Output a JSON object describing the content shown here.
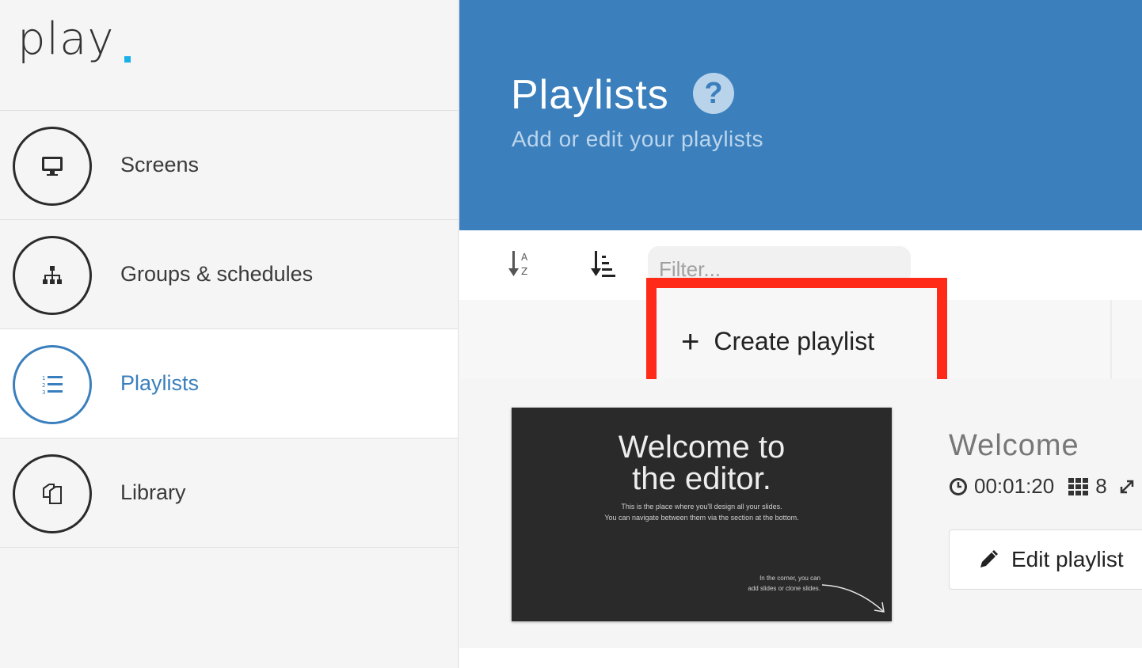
{
  "app": {
    "logo_text": "play",
    "accent_color": "#1ab0e8"
  },
  "sidebar": {
    "items": [
      {
        "label": "Screens",
        "icon": "monitor-icon",
        "active": false
      },
      {
        "label": "Groups & schedules",
        "icon": "sitemap-icon",
        "active": false
      },
      {
        "label": "Playlists",
        "icon": "ordered-list-icon",
        "active": true
      },
      {
        "label": "Library",
        "icon": "copy-icon",
        "active": false
      }
    ]
  },
  "header": {
    "title": "Playlists",
    "subtitle": "Add or edit your playlists",
    "color": "#3b80bd"
  },
  "toolbar": {
    "filter_placeholder": "Filter..."
  },
  "create": {
    "label": "Create playlist",
    "highlight_color": "#ff2a17"
  },
  "playlist": {
    "name": "Welcome",
    "duration": "00:01:20",
    "slide_count": "8",
    "edit_label": "Edit playlist",
    "thumbnail": {
      "title_line1": "Welcome to",
      "title_line2": "the editor.",
      "body_line1": "This is the place where you'll design all your slides.",
      "body_line2": "You can navigate between them via the section at the bottom.",
      "corner_line1": "In the corner, you can",
      "corner_line2": "add slides or clone slides."
    }
  }
}
